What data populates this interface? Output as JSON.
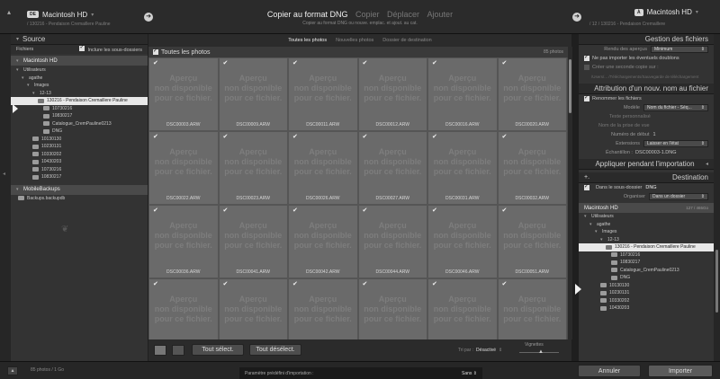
{
  "header": {
    "source_badge": "DE",
    "source_volume": "Macintosh HD",
    "source_path": "/ 130216 - Pendaison Cremaillere Pauline",
    "modes": [
      "Copier au format DNG",
      "Copier",
      "Déplacer",
      "Ajouter"
    ],
    "active_mode": "Copier au format DNG",
    "mode_subtitle": "Copier au format DNG ou nouve. emplac. et ajout. au cat.",
    "dest_badge": "À",
    "dest_volume": "Macintosh HD",
    "dest_path": "/ 12 / 130216 - Pendaison Cremaillere"
  },
  "source_panel": {
    "title": "Source",
    "files_label": "Fichiers",
    "include_sub": "Inclure les sous-dossiers",
    "volume": "Macintosh HD",
    "tree": [
      {
        "label": "Utilisateurs",
        "level": 0,
        "type": "tri"
      },
      {
        "label": "agathe",
        "level": 1,
        "type": "tri"
      },
      {
        "label": "Images",
        "level": 2,
        "type": "tri"
      },
      {
        "label": "12-13",
        "level": 3,
        "type": "tri"
      },
      {
        "label": "130216 - Pendaison Cremaillere Pauline",
        "level": 4,
        "type": "folder",
        "selected": true
      },
      {
        "label": "10730216",
        "level": 5,
        "type": "folder"
      },
      {
        "label": "10830217",
        "level": 5,
        "type": "folder"
      },
      {
        "label": "Catalogue_CremPauline0213",
        "level": 5,
        "type": "folder"
      },
      {
        "label": "DNG",
        "level": 5,
        "type": "folder"
      },
      {
        "label": "10130130",
        "level": 3,
        "type": "folder"
      },
      {
        "label": "10230131",
        "level": 3,
        "type": "folder"
      },
      {
        "label": "10330202",
        "level": 3,
        "type": "folder"
      },
      {
        "label": "10430203",
        "level": 3,
        "type": "folder"
      },
      {
        "label": "10730216",
        "level": 3,
        "type": "folder"
      },
      {
        "label": "10830217",
        "level": 3,
        "type": "folder"
      }
    ],
    "backup_volume": "MobileBackups",
    "backup_item": "Backups.backupdb"
  },
  "center": {
    "tabs": [
      "Toutes les photos",
      "Nouvelles photos",
      "Dossier de destination"
    ],
    "active_tab": "Toutes les photos",
    "grid_title": "Toutes les photos",
    "photo_count": "85 photos",
    "placeholder_lines": [
      "Aperçu",
      "non disponible",
      "pour ce fichier."
    ],
    "files": [
      "DSC00003.ARW",
      "DSC00009.ARW",
      "DSC00011.ARW",
      "DSC00012.ARW",
      "DSC00016.ARW",
      "DSC00020.ARW",
      "DSC00022.ARW",
      "DSC00023.ARW",
      "DSC00026.ARW",
      "DSC00027.ARW",
      "DSC00031.ARW",
      "DSC00032.ARW",
      "DSC00036.ARW",
      "DSC00041.ARW",
      "DSC00042.ARW",
      "DSC00044.ARW",
      "DSC00046.ARW",
      "DSC00051.ARW",
      "",
      "",
      "",
      "",
      "",
      ""
    ],
    "select_all": "Tout sélect.",
    "deselect_all": "Tout désélect.",
    "sort_label": "Tri par :",
    "sort_value": "Désactivé",
    "thumbs_label": "Vignettes"
  },
  "right_panel": {
    "file_mgmt_title": "Gestion des fichiers",
    "preview_label": "Rendu des aperçus",
    "preview_value": "Minimum",
    "no_dupes": "Ne pas importer les éventuels doublons",
    "second_copy": "Créer une seconde copie sur :",
    "second_copy_path": "/Users/... /Téléchargements/Sauvegarde de téléchargement",
    "rename_title": "Attribution d'un nouv. nom au fichier",
    "rename_files": "Renommer les fichiers",
    "model_label": "Modèle",
    "model_value": "Nom du fichier - Séq...",
    "custom_text_label": "Texte personnalisé",
    "shoot_name_label": "Nom de la prise de vue",
    "start_number_label": "Numéro de début",
    "start_number_value": "1",
    "extensions_label": "Extensions",
    "extensions_value": "Laisser en l'état",
    "sample_label": "Échantillon :",
    "sample_value": "DSC00003-1.DNG",
    "apply_title": "Appliquer pendant l'importation",
    "dest_title": "Destination",
    "dest_plus": "+.",
    "into_subfolder": "Dans le sous-dossier",
    "subfolder_value": "DNG",
    "organise_label": "Organiser",
    "organise_value": "Dans un dossier",
    "dest_volume": "Macintosh HD",
    "dest_volume_info": "127 / 465Go",
    "dest_tree": [
      {
        "label": "Utilisateurs",
        "level": 0,
        "type": "tri"
      },
      {
        "label": "agathe",
        "level": 1,
        "type": "tri"
      },
      {
        "label": "Images",
        "level": 2,
        "type": "tri"
      },
      {
        "label": "12-13",
        "level": 3,
        "type": "tri"
      },
      {
        "label": "130216 - Pendaison Cremaillere Pauline",
        "level": 4,
        "type": "folder",
        "selected": true
      },
      {
        "label": "10730216",
        "level": 5,
        "type": "folder"
      },
      {
        "label": "10830217",
        "level": 5,
        "type": "folder"
      },
      {
        "label": "Catalogue_CremPauline0213",
        "level": 5,
        "type": "folder"
      },
      {
        "label": "DNG",
        "level": 5,
        "type": "folder"
      },
      {
        "label": "10130130",
        "level": 3,
        "type": "folder"
      },
      {
        "label": "10230131",
        "level": 3,
        "type": "folder"
      },
      {
        "label": "10330202",
        "level": 3,
        "type": "folder"
      },
      {
        "label": "10430203",
        "level": 3,
        "type": "folder"
      }
    ]
  },
  "footer": {
    "count": "85 photos / 1 Go",
    "preset_label": "Paramètre prédéfini d'importation :",
    "preset_value": "Sans",
    "cancel": "Annuler",
    "import": "Importer"
  }
}
